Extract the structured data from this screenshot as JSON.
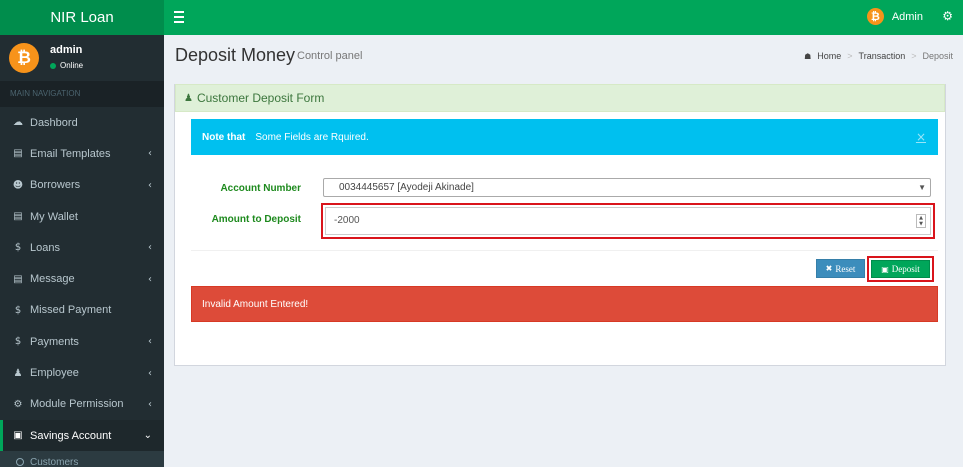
{
  "app": {
    "title": "NIR Loan",
    "user_label": "Admin"
  },
  "sidebar": {
    "user": {
      "name": "admin",
      "status": "Online"
    },
    "header": "MAIN NAVIGATION",
    "items": [
      {
        "label": "Dashbord",
        "icon": "dashboard-icon",
        "glyph": "☁",
        "chevron": false
      },
      {
        "label": "Email Templates",
        "icon": "book-icon",
        "glyph": "▤",
        "chevron": true
      },
      {
        "label": "Borrowers",
        "icon": "users-icon",
        "glyph": "☻",
        "chevron": true
      },
      {
        "label": "My Wallet",
        "icon": "book-icon",
        "glyph": "▤",
        "chevron": false
      },
      {
        "label": "Loans",
        "icon": "dollar-icon",
        "glyph": "$",
        "chevron": true
      },
      {
        "label": "Message",
        "icon": "book-icon",
        "glyph": "▤",
        "chevron": true
      },
      {
        "label": "Missed Payment",
        "icon": "dollar-icon",
        "glyph": "$",
        "chevron": false
      },
      {
        "label": "Payments",
        "icon": "dollar-icon",
        "glyph": "$",
        "chevron": true
      },
      {
        "label": "Employee",
        "icon": "user-icon",
        "glyph": "♟",
        "chevron": true
      },
      {
        "label": "Module Permission",
        "icon": "gears-icon",
        "glyph": "⚙",
        "chevron": true
      },
      {
        "label": "Savings Account",
        "icon": "money-icon",
        "glyph": "▣",
        "chevron": true,
        "active": true
      }
    ],
    "sub_items": [
      {
        "label": "Customers"
      }
    ]
  },
  "content": {
    "title": "Deposit Money",
    "subtitle": "Control panel",
    "breadcrumb": {
      "home": "Home",
      "middle": "Transaction",
      "current": "Deposit"
    }
  },
  "form": {
    "header": "Customer Deposit Form",
    "info_bold": "Note that",
    "info_text": "Some Fields are Rquired.",
    "info_close": "×",
    "account_label": "Account Number",
    "account_value": "0034445657  [Ayodeji Akinade]",
    "amount_label": "Amount to Deposit",
    "amount_value": "-2000",
    "reset_label": "Reset",
    "deposit_label": "Deposit",
    "error_text": "Invalid Amount Entered!"
  },
  "colors": {
    "brand": "#00a65a",
    "sidebar": "#222d32",
    "info": "#00c0ef",
    "danger": "#dd4b39",
    "highlight": "#d9141b"
  }
}
